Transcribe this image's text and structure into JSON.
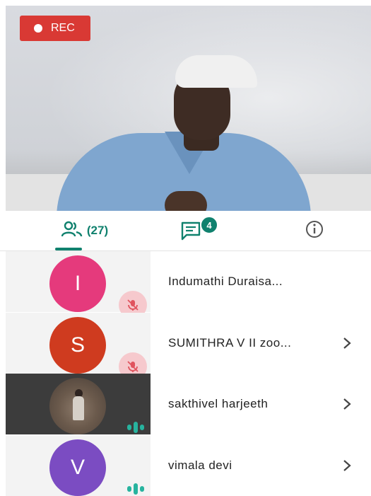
{
  "recording": {
    "label": "REC"
  },
  "tabs": {
    "people_count": "(27)",
    "chat_badge": "4"
  },
  "participants": [
    {
      "initial": "I",
      "name": "Indumathi Duraisa...",
      "avatar_color": "#e53a7c",
      "status": "muted",
      "has_chevron": false
    },
    {
      "initial": "S",
      "name": "SUMITHRA V II zoo...",
      "avatar_color": "#cf3b1f",
      "status": "muted",
      "has_chevron": true
    },
    {
      "initial": "",
      "name": "sakthivel harjeeth",
      "avatar_color": "photo",
      "status": "speaking",
      "has_chevron": true,
      "selected": true
    },
    {
      "initial": "V",
      "name": "vimala devi",
      "avatar_color": "#7b4cc2",
      "status": "speaking",
      "has_chevron": true
    }
  ],
  "colors": {
    "accent": "#10816e",
    "rec": "#d93934",
    "muted_icon": "#e0545e",
    "speaking": "#27b39e"
  }
}
